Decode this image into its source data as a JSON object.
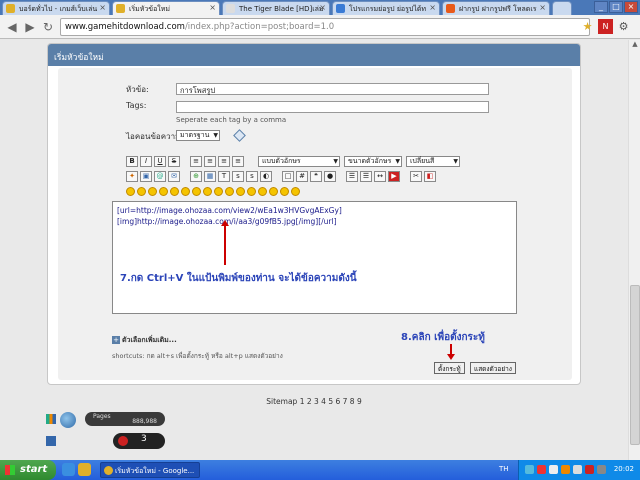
{
  "browser": {
    "tabs": [
      {
        "title": "บอร์ดทั่วไป - เกมส์เว็บเล่น"
      },
      {
        "title": "เริ่มหัวข้อใหม่"
      },
      {
        "title": "The Tiger Blade [HD]เล่ม"
      },
      {
        "title": "โปรแกรมย่อรูป ย่อรูปได้ท"
      },
      {
        "title": "ฝากรูป ฝากรูปฟรี โหลดเร"
      }
    ],
    "url_host": "www.gamehitdownload.com",
    "url_path": "/index.php?action=post;board=1.0"
  },
  "form": {
    "header": "เริ่มหัวข้อใหม่",
    "subject_label": "หัวข้อ:",
    "subject_value": "การโพสรูป",
    "tags_label": "Tags:",
    "tags_value": "",
    "tags_hint": "Seperate each tag by a comma",
    "icon_label": "ไอคอนข้อความ:",
    "icon_value": "มาตรฐาน",
    "font_face": "แบบตัวอักษร",
    "font_size": "ขนาดตัวอักษร",
    "font_color": "เปลี่ยนสี",
    "body_line1": "[url=http://image.ohozaa.com/view2/wEa1w3HVGvgAExGy]",
    "body_line2": "[img]http://image.ohozaa.com/i/aa3/g09fB5.jpg[/img][/url]",
    "more_options": "ตัวเลือกเพิ่มเติม...",
    "shortcuts": "shortcuts: กด alt+s เพื่อตั้งกระทู้ หรือ alt+p แสดงตัวอย่าง",
    "post_button": "ตั้งกระทู้",
    "preview_button": "แสดงตัวอย่าง"
  },
  "annotations": {
    "step7": "7.กด Ctrl+V ในแป้นพิมพ์ของท่าน จะได้ข้อความดังนี้",
    "step8": "8.คลิก เพื่อตั้งกระทู้"
  },
  "footer": {
    "sitemap_label": "Sitemap",
    "sitemap_pages": "1 2 3 4 5 6 7 8 9",
    "pages_label": "Pages",
    "pages_count": "888,988",
    "online_count": "3"
  },
  "taskbar": {
    "start": "start",
    "task": "เริ่มหัวข้อใหม่ - Google...",
    "lang": "TH",
    "clock": "20:02"
  }
}
